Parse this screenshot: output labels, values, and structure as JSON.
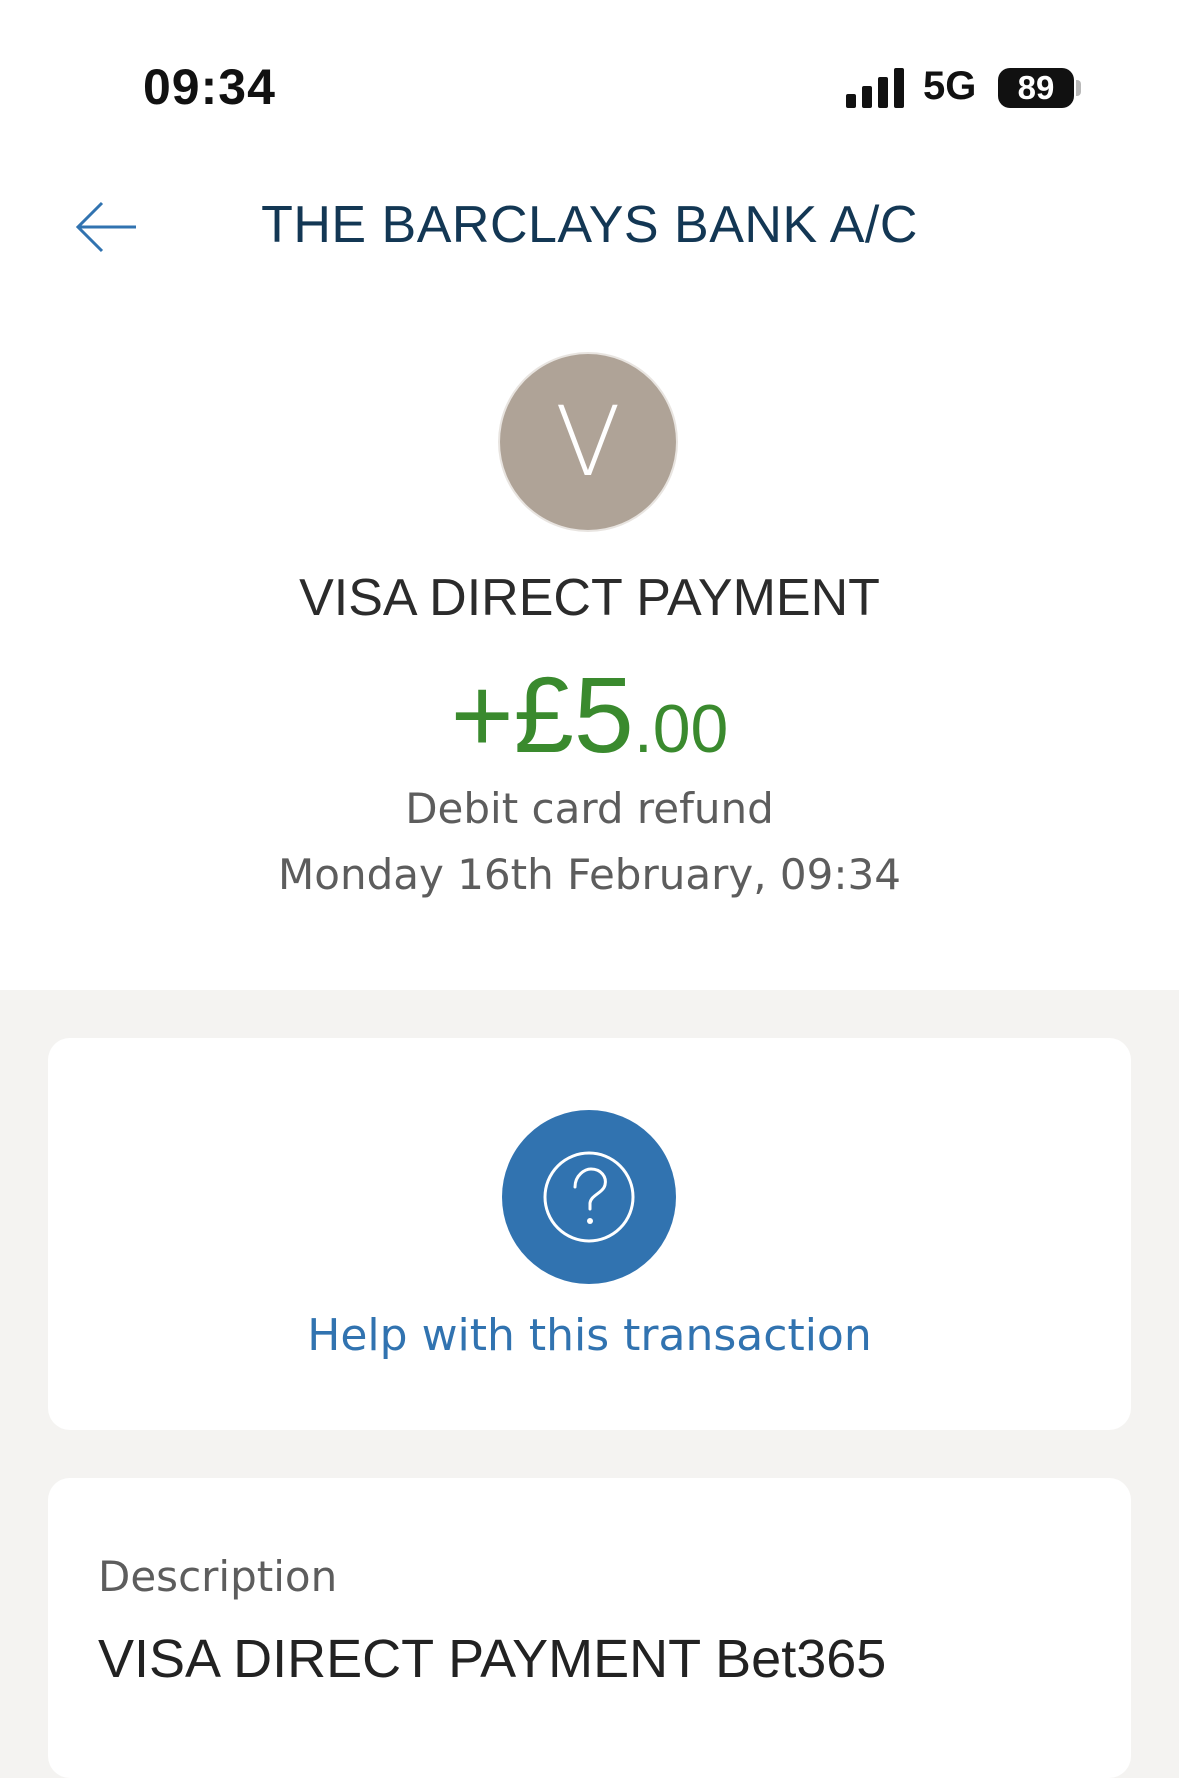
{
  "status_bar": {
    "time": "09:34",
    "network": "5G",
    "battery": "89"
  },
  "header": {
    "title": "THE BARCLAYS BANK A/C",
    "back_icon": "arrow-left-icon"
  },
  "transaction": {
    "avatar_initial": "V",
    "merchant": "VISA DIRECT PAYMENT",
    "amount_main": "+£5",
    "amount_pence": ".00",
    "type": "Debit card refund",
    "datetime": "Monday 16th February, 09:34",
    "amount_color": "#3a8a2e"
  },
  "help": {
    "icon": "question-circle-icon",
    "label": "Help with this transaction",
    "accent": "#3173b0"
  },
  "description": {
    "label": "Description",
    "value": "VISA DIRECT PAYMENT Bet365"
  }
}
